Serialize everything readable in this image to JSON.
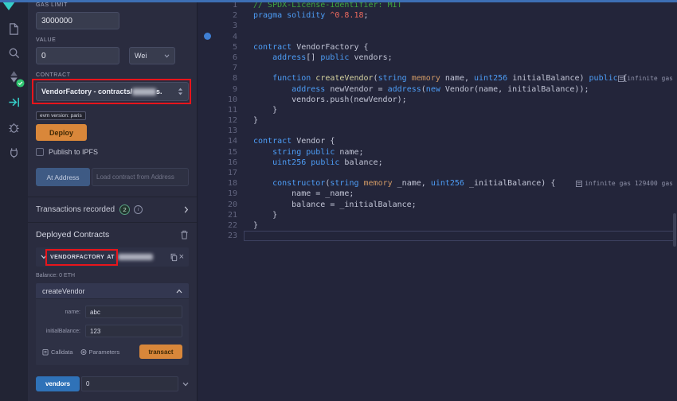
{
  "colors": {
    "top_accent": "#3d6fb4",
    "active_icon": "#35cfc9",
    "annotation_red": "#e8151b",
    "warning_orange": "#d9873a",
    "primary_blue": "#2f72b8",
    "compile_success_green": "#2ec46f"
  },
  "activity_bar": {
    "icons": [
      "remix-logo-partial",
      "file-explorer-icon",
      "search-icon",
      "solidity-compiler-icon",
      "compile-success-check-icon",
      "deploy-run-icon",
      "debugger-icon",
      "plugin-manager-icon"
    ]
  },
  "panel": {
    "gas_limit_label": "GAS LIMIT",
    "gas_limit_value": "3000000",
    "value_label": "VALUE",
    "value_value": "0",
    "value_unit": "Wei",
    "contract_label": "CONTRACT",
    "contract_selected_prefix": "VendorFactory - contracts/",
    "contract_selected_suffix": "s.",
    "evm_version_badge": "evm version: paris",
    "deploy_button": "Deploy",
    "publish_checkbox_label": "Publish to IPFS",
    "at_address_button": "At Address",
    "at_address_placeholder": "Load contract from Address",
    "transactions_label": "Transactions recorded",
    "transactions_count": "2",
    "info_icon_glyph": "i",
    "deployed_header": "Deployed Contracts",
    "deployed_contract_name": "VENDORFACTORY",
    "deployed_contract_at": "AT",
    "close_glyph": "×",
    "balance_text": "Balance: 0 ETH",
    "function_header": "createVendor",
    "field_name_label": "name:",
    "field_name_value": "abc",
    "field_balance_label": "initialBalance:",
    "field_balance_value": "123",
    "calldata_label": "Calldata",
    "parameters_label": "Parameters",
    "transact_button": "transact",
    "vendors_button": "vendors",
    "vendors_value": "0"
  },
  "editor": {
    "lines": [
      {
        "n": 1,
        "t": [
          {
            "c": "com",
            "s": "// SPDX-License-Identifier: MIT"
          }
        ]
      },
      {
        "n": 2,
        "t": [
          {
            "c": "kw",
            "s": "pragma solidity"
          },
          {
            "c": "pl",
            "s": " "
          },
          {
            "c": "num",
            "s": "^0.8.18"
          },
          {
            "c": "pl",
            "s": ";"
          }
        ]
      },
      {
        "n": 3,
        "t": []
      },
      {
        "n": 4,
        "t": []
      },
      {
        "n": 5,
        "t": [
          {
            "c": "kw",
            "s": "contract"
          },
          {
            "c": "pl",
            "s": " VendorFactory {"
          }
        ]
      },
      {
        "n": 6,
        "t": [
          {
            "c": "pl",
            "s": "    "
          },
          {
            "c": "kw",
            "s": "address"
          },
          {
            "c": "pl",
            "s": "[] "
          },
          {
            "c": "kw",
            "s": "public"
          },
          {
            "c": "pl",
            "s": " vendors;"
          }
        ]
      },
      {
        "n": 7,
        "t": []
      },
      {
        "n": 8,
        "t": [
          {
            "c": "pl",
            "s": "    "
          },
          {
            "c": "kw",
            "s": "function"
          },
          {
            "c": "pl",
            "s": " "
          },
          {
            "c": "fn",
            "s": "createVendor"
          },
          {
            "c": "pl",
            "s": "("
          },
          {
            "c": "kw",
            "s": "string"
          },
          {
            "c": "pl",
            "s": " "
          },
          {
            "c": "mod",
            "s": "memory"
          },
          {
            "c": "pl",
            "s": " name, "
          },
          {
            "c": "kw",
            "s": "uint256"
          },
          {
            "c": "pl",
            "s": " initialBalance) "
          },
          {
            "c": "kw",
            "s": "public"
          },
          {
            "c": "pl",
            "s": " {"
          }
        ],
        "gas": "infinite gas"
      },
      {
        "n": 9,
        "t": [
          {
            "c": "pl",
            "s": "        "
          },
          {
            "c": "kw",
            "s": "address"
          },
          {
            "c": "pl",
            "s": " newVendor = "
          },
          {
            "c": "kw",
            "s": "address"
          },
          {
            "c": "pl",
            "s": "("
          },
          {
            "c": "kw",
            "s": "new"
          },
          {
            "c": "pl",
            "s": " Vendor(name, initialBalance));"
          }
        ]
      },
      {
        "n": 10,
        "t": [
          {
            "c": "pl",
            "s": "        vendors.push(newVendor);"
          }
        ]
      },
      {
        "n": 11,
        "t": [
          {
            "c": "pl",
            "s": "    }"
          }
        ]
      },
      {
        "n": 12,
        "t": [
          {
            "c": "pl",
            "s": "}"
          }
        ]
      },
      {
        "n": 13,
        "t": []
      },
      {
        "n": 14,
        "t": [
          {
            "c": "kw",
            "s": "contract"
          },
          {
            "c": "pl",
            "s": " Vendor {"
          }
        ]
      },
      {
        "n": 15,
        "t": [
          {
            "c": "pl",
            "s": "    "
          },
          {
            "c": "kw",
            "s": "string"
          },
          {
            "c": "pl",
            "s": " "
          },
          {
            "c": "kw",
            "s": "public"
          },
          {
            "c": "pl",
            "s": " name;"
          }
        ]
      },
      {
        "n": 16,
        "t": [
          {
            "c": "pl",
            "s": "    "
          },
          {
            "c": "kw",
            "s": "uint256"
          },
          {
            "c": "pl",
            "s": " "
          },
          {
            "c": "kw",
            "s": "public"
          },
          {
            "c": "pl",
            "s": " balance;"
          }
        ]
      },
      {
        "n": 17,
        "t": []
      },
      {
        "n": 18,
        "t": [
          {
            "c": "pl",
            "s": "    "
          },
          {
            "c": "kw",
            "s": "constructor"
          },
          {
            "c": "pl",
            "s": "("
          },
          {
            "c": "kw",
            "s": "string"
          },
          {
            "c": "pl",
            "s": " "
          },
          {
            "c": "mod",
            "s": "memory"
          },
          {
            "c": "pl",
            "s": " _name, "
          },
          {
            "c": "kw",
            "s": "uint256"
          },
          {
            "c": "pl",
            "s": " _initialBalance) {"
          }
        ],
        "gas": "infinite gas 129400 gas"
      },
      {
        "n": 19,
        "t": [
          {
            "c": "pl",
            "s": "        name = _name;"
          }
        ]
      },
      {
        "n": 20,
        "t": [
          {
            "c": "pl",
            "s": "        balance = _initialBalance;"
          }
        ]
      },
      {
        "n": 21,
        "t": [
          {
            "c": "pl",
            "s": "    }"
          }
        ]
      },
      {
        "n": 22,
        "t": [
          {
            "c": "pl",
            "s": "}"
          }
        ]
      },
      {
        "n": 23,
        "t": [],
        "cur": true
      }
    ]
  }
}
